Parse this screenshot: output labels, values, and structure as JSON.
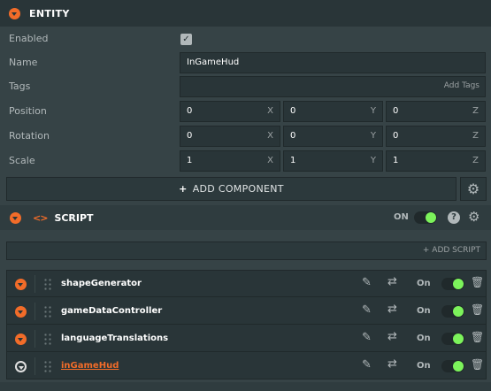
{
  "entity": {
    "title": "ENTITY",
    "enabled_label": "Enabled",
    "enabled_checked": true,
    "name_label": "Name",
    "name_value": "InGameHud",
    "tags_label": "Tags",
    "tags_placeholder": "Add Tags",
    "position_label": "Position",
    "position": {
      "x": "0",
      "y": "0",
      "z": "0"
    },
    "rotation_label": "Rotation",
    "rotation": {
      "x": "0",
      "y": "0",
      "z": "0"
    },
    "scale_label": "Scale",
    "scale": {
      "x": "1",
      "y": "1",
      "z": "1"
    },
    "axis_labels": {
      "x": "X",
      "y": "Y",
      "z": "Z"
    },
    "add_component_label": "ADD COMPONENT"
  },
  "script_component": {
    "title": "SCRIPT",
    "toggle_label": "ON",
    "enabled": true,
    "add_script_label": "+ ADD SCRIPT",
    "items": [
      {
        "name": "shapeGenerator",
        "toggle_label": "On",
        "enabled": true
      },
      {
        "name": "gameDataController",
        "toggle_label": "On",
        "enabled": true
      },
      {
        "name": "languageTranslations",
        "toggle_label": "On",
        "enabled": true
      },
      {
        "name": "inGameHud",
        "toggle_label": "On",
        "enabled": true,
        "is_link": true
      }
    ]
  },
  "icons": {
    "collapse": "chevron-down-circle-icon",
    "code": "code-brackets-icon",
    "settings": "gear-icon",
    "help": "question-icon",
    "edit": "edit-icon",
    "reload": "reload-icon",
    "delete": "trash-icon",
    "drag": "drag-handle-icon",
    "check": "checkmark-icon",
    "plus": "plus-icon"
  },
  "colors": {
    "accent": "#f26c29",
    "toggle_on": "#7cf35b",
    "panel_bg": "#364346",
    "field_bg": "#293538",
    "header_bg": "#293538"
  }
}
